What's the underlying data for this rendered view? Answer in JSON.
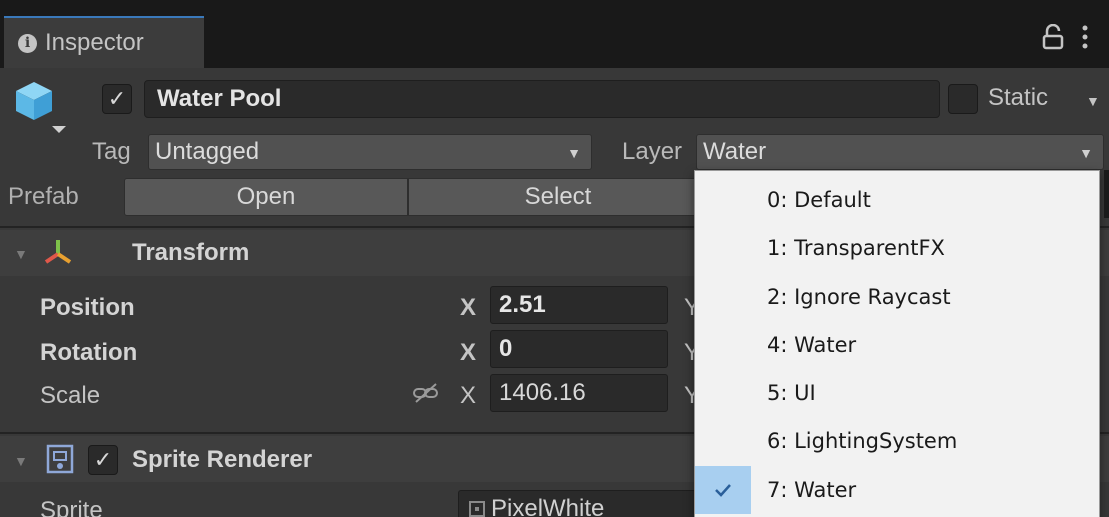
{
  "tab": {
    "label": "Inspector"
  },
  "header": {
    "name": "Water Pool",
    "active_check": "✓",
    "static_label": "Static",
    "tag_label": "Tag",
    "tag_value": "Untagged",
    "layer_label": "Layer",
    "layer_value": "Water"
  },
  "prefab": {
    "label": "Prefab",
    "open_label": "Open",
    "select_label": "Select"
  },
  "transform": {
    "title": "Transform",
    "rows": [
      {
        "label": "Position",
        "axis": "X",
        "value": "2.51",
        "y": "Y"
      },
      {
        "label": "Rotation",
        "axis": "X",
        "value": "0",
        "y": "Y"
      },
      {
        "label": "Scale",
        "axis": "X",
        "value": "1406.16",
        "y": "Y"
      }
    ]
  },
  "sprite_renderer": {
    "title": "Sprite Renderer",
    "enabled_check": "✓",
    "sprite_label": "Sprite",
    "sprite_value": "PixelWhite"
  },
  "layer_menu": {
    "items": [
      {
        "label": "0: Default",
        "selected": false
      },
      {
        "label": "1: TransparentFX",
        "selected": false
      },
      {
        "label": "2: Ignore Raycast",
        "selected": false
      },
      {
        "label": "4: Water",
        "selected": false
      },
      {
        "label": "5: UI",
        "selected": false
      },
      {
        "label": "6: LightingSystem",
        "selected": false
      },
      {
        "label": "7: Water",
        "selected": true
      }
    ]
  },
  "colors": {
    "accent": "#3a79bb",
    "selection_highlight": "#a8cff0",
    "panel_bg": "#383838"
  }
}
